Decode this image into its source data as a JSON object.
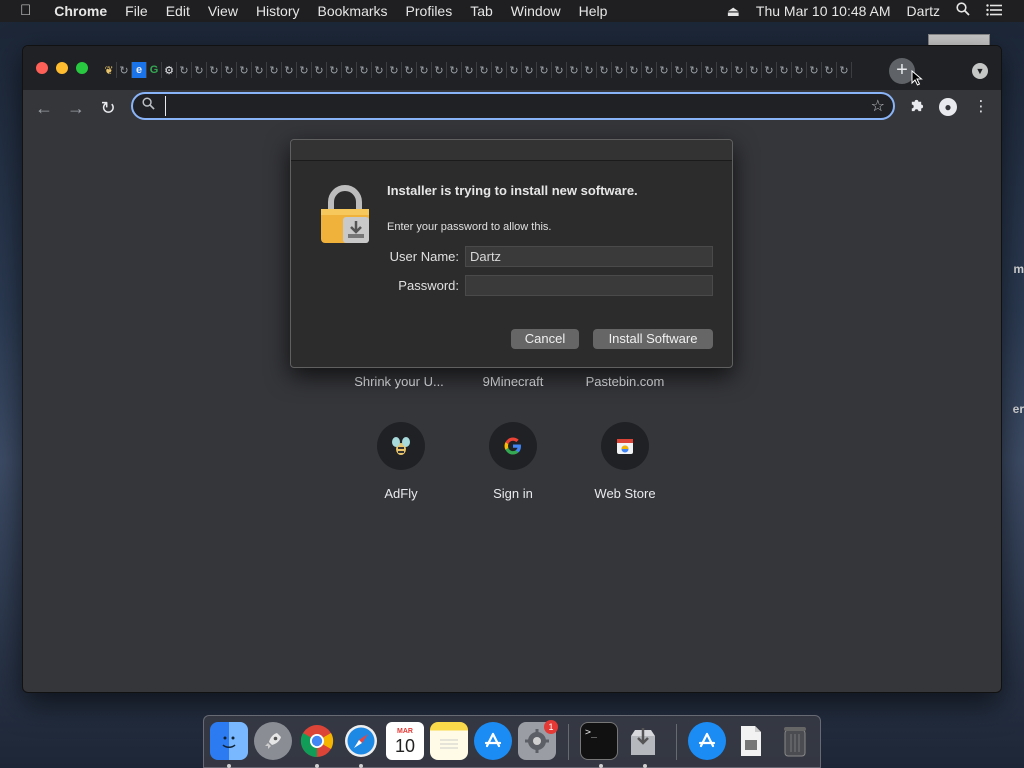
{
  "menubar": {
    "app_name": "Chrome",
    "menus": [
      "File",
      "Edit",
      "View",
      "History",
      "Bookmarks",
      "Profiles",
      "Tab",
      "Window",
      "Help"
    ],
    "clock": "Thu Mar 10  10:48 AM",
    "user": "Dartz"
  },
  "desktop": {
    "partial_label_1": "m",
    "partial_label_2": "er"
  },
  "browser": {
    "tabs": [
      "adfly",
      "spin",
      "e",
      "g",
      "gear",
      "spin",
      "spin",
      "spin",
      "spin",
      "spin",
      "spin",
      "spin",
      "spin",
      "spin",
      "spin",
      "spin",
      "spin",
      "spin",
      "spin",
      "spin",
      "spin",
      "spin",
      "spin",
      "spin",
      "spin",
      "spin",
      "spin",
      "spin",
      "spin",
      "spin",
      "spin",
      "spin",
      "spin",
      "spin",
      "spin",
      "spin",
      "spin",
      "spin",
      "spin",
      "spin",
      "spin",
      "spin",
      "spin",
      "spin",
      "spin",
      "spin",
      "spin",
      "spin",
      "spin",
      "spin"
    ],
    "address_value": "",
    "shortcuts_top": [
      "Shrink your U...",
      "9Minecraft",
      "Pastebin.com"
    ],
    "shortcuts_bottom": [
      "AdFly",
      "Sign in",
      "Web Store"
    ]
  },
  "dialog": {
    "heading": "Installer is trying to install new software.",
    "message": "Enter your password to allow this.",
    "username_label": "User Name:",
    "username_value": "Dartz",
    "password_label": "Password:",
    "password_value": "",
    "cancel_label": "Cancel",
    "install_label": "Install Software"
  },
  "dock": {
    "items": [
      "Finder",
      "Launchpad",
      "Chrome",
      "Safari",
      "Calendar",
      "Notes",
      "App Store",
      "System Preferences",
      "Terminal",
      "Installer",
      "App Store",
      "Document",
      "Trash"
    ],
    "calendar_month": "MAR",
    "calendar_day": "10",
    "system_prefs_badge": "1"
  },
  "colors": {
    "omnibox_focus": "#8ab4f8",
    "close": "#fe5f57",
    "minimize": "#febc2e",
    "maximize": "#28c840",
    "lock_gold": "#f0b23a"
  }
}
